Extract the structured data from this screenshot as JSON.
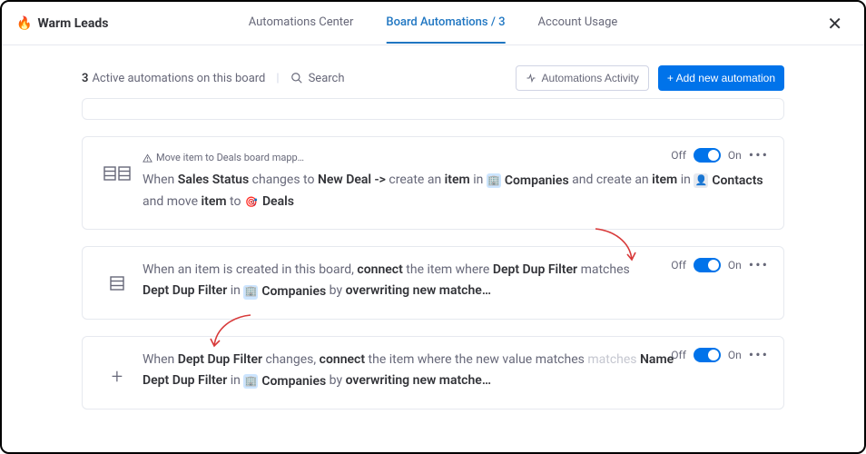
{
  "header": {
    "board_name": "Warm Leads",
    "tabs": {
      "center": "Automations Center",
      "board": "Board Automations / 3",
      "usage": "Account Usage"
    }
  },
  "subheader": {
    "active_count": "3",
    "active_text": "Active automations on this board",
    "search": "Search",
    "activity_btn": "Automations Activity",
    "add_btn": "+ Add new automation"
  },
  "card1": {
    "warn": "Move item to Deals board mapp…",
    "t1": "When",
    "t2": "Sales Status",
    "t3": "changes to",
    "t4": "New Deal ->",
    "t5": "create an",
    "t6": "item",
    "t7": "in",
    "t8": "Companies",
    "t9": "and create an",
    "t10": "item",
    "t11": "in",
    "t12": "Contacts",
    "t13": "and move",
    "t14": "item",
    "t15": "to",
    "t16": "Deals"
  },
  "card2": {
    "t1": "When an item is created in this board,",
    "t2": "connect",
    "t3": "the item where",
    "t4": "Dept Dup Filter",
    "t5": "matches",
    "t6": "Dept Dup Filter",
    "t7": "in",
    "t8": "Companies",
    "t9": "by",
    "t10": "overwriting new matche…"
  },
  "card3": {
    "t1": "When",
    "t2": "Dept Dup Filter",
    "t3": "changes,",
    "t4": "connect",
    "t5": "the item where the new value matches",
    "t5b": "matches",
    "t6": "Name",
    "t7": "Dept Dup Filter",
    "t8": "in",
    "t9": "Companies",
    "t10": "by",
    "t11": "overwriting new matche…"
  },
  "toggle": {
    "off": "Off",
    "on": "On"
  }
}
